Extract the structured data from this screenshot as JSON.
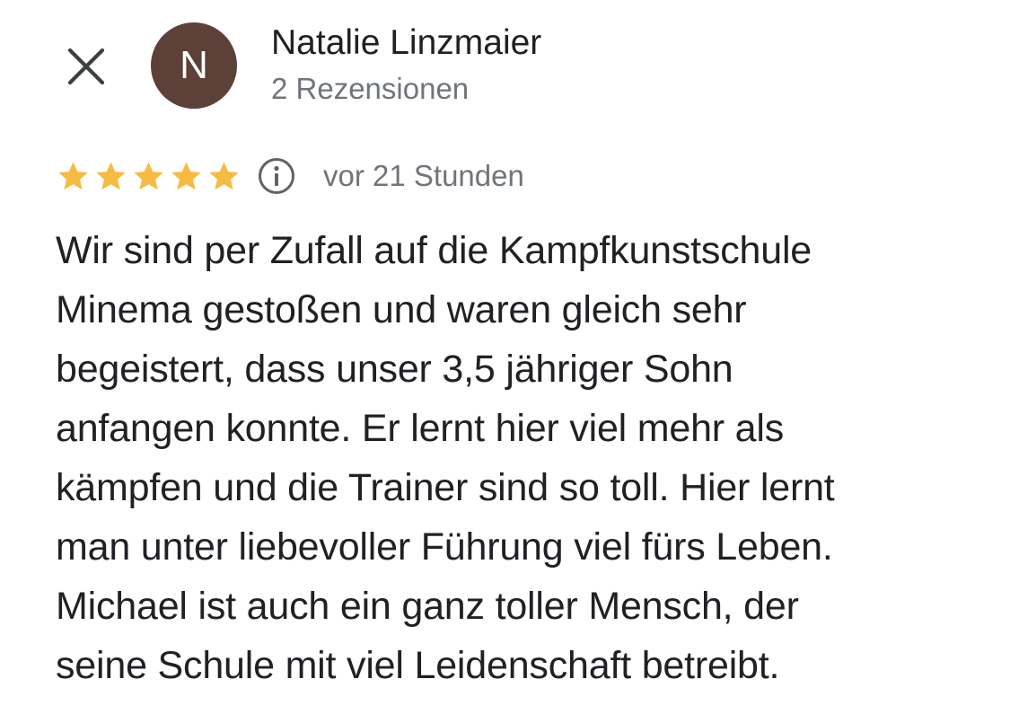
{
  "reviewer": {
    "initial": "N",
    "name": "Natalie Linzmaier",
    "review_count": "2 Rezensionen",
    "avatar_color": "#5d4037"
  },
  "review": {
    "rating": 5,
    "max_rating": 5,
    "star_color": "#f6bb42",
    "timestamp": "vor 21 Stunden",
    "lines": [
      "Wir sind per Zufall auf die Kampfkunstschule",
      "Minema gestoßen und waren gleich sehr",
      "begeistert, dass unser 3,5 jähriger Sohn",
      "anfangen konnte. Er lernt hier viel mehr als",
      "kämpfen und die Trainer sind so toll. Hier lernt",
      "man unter liebevoller Führung viel fürs Leben.",
      "Michael ist auch ein ganz toller Mensch, der",
      "seine Schule mit viel Leidenschaft betreibt."
    ]
  },
  "icons": {
    "close": "close-icon",
    "star": "star-icon",
    "info": "info-icon"
  }
}
